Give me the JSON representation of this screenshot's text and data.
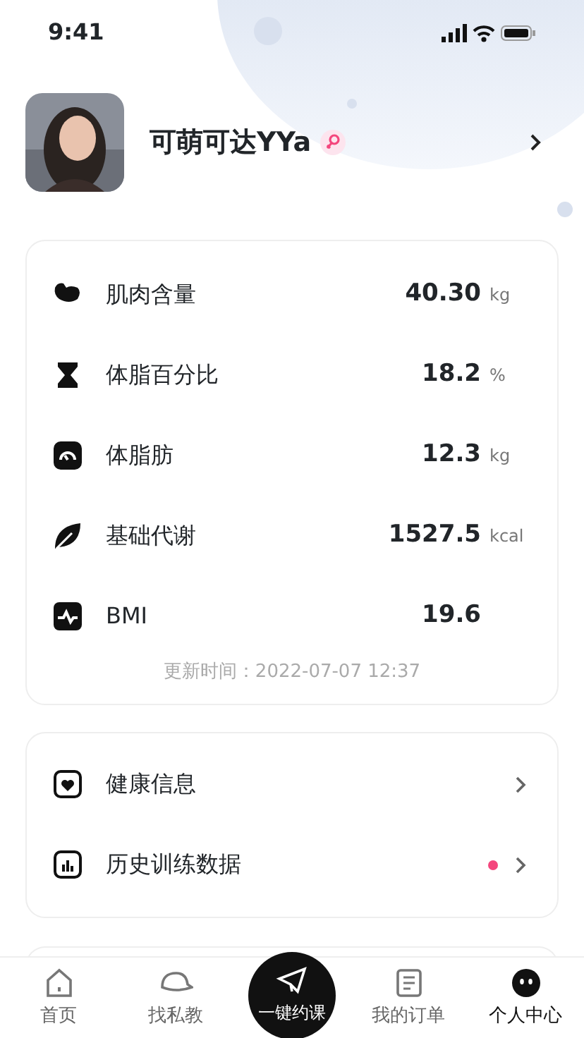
{
  "status_bar": {
    "time": "9:41"
  },
  "profile": {
    "name": "可萌可达YYa"
  },
  "metrics": [
    {
      "label": "肌肉含量",
      "value": "40.30",
      "unit": "kg"
    },
    {
      "label": "体脂百分比",
      "value": "18.2",
      "unit": "%"
    },
    {
      "label": "体脂肪",
      "value": "12.3",
      "unit": "kg"
    },
    {
      "label": "基础代谢",
      "value": "1527.5",
      "unit": "kcal"
    },
    {
      "label": "BMI",
      "value": "19.6"
    }
  ],
  "updated": "更新时间：2022-07-07  12:37",
  "menu": [
    {
      "label": "健康信息",
      "unread": false
    },
    {
      "label": "历史训练数据",
      "unread": true
    }
  ],
  "tabs": [
    {
      "label": "首页",
      "selected": false
    },
    {
      "label": "找私教",
      "selected": false
    },
    {
      "label": "一键约课",
      "selected": false,
      "kind": "center"
    },
    {
      "label": "我的订单",
      "selected": false
    },
    {
      "label": "个人中心",
      "selected": true
    }
  ]
}
